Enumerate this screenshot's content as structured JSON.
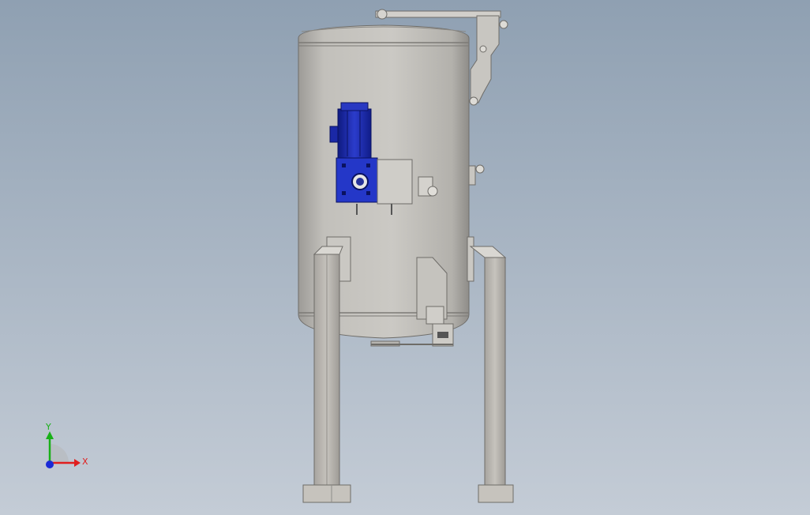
{
  "viewport": {
    "background_top": "#8fa0b2",
    "background_bottom": "#c4ccd6"
  },
  "model": {
    "vessel_color": "#c3c1bc",
    "motor_color": "#1f2fb0",
    "gearbox_color": "#2437c8",
    "frame_color": "#bcb9b3"
  },
  "triad": {
    "x_label": "X",
    "y_label": "Y",
    "x_color": "#e01e1e",
    "y_color": "#18b018",
    "z_color": "#1a2ad6"
  }
}
